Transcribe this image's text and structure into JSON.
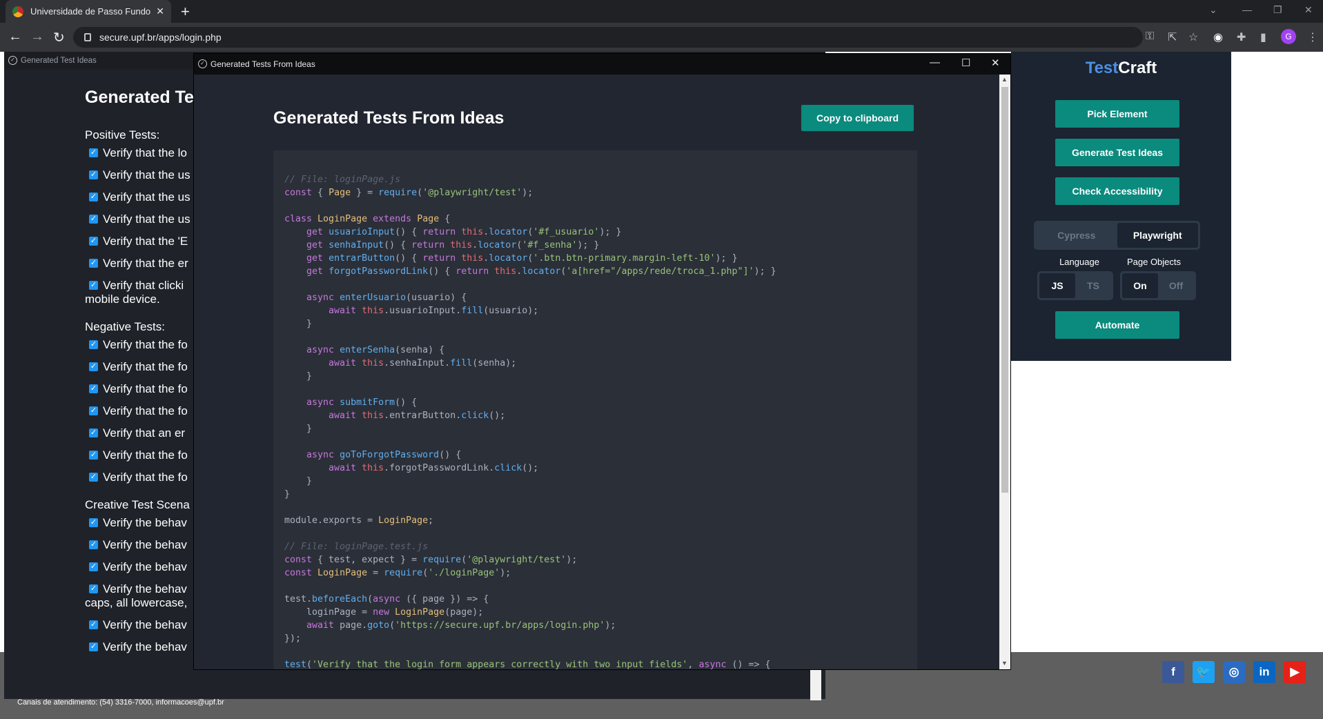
{
  "browser": {
    "tab_title": "Universidade de Passo Fundo - U",
    "url": "secure.upf.br/apps/login.php"
  },
  "page": {
    "footer_text": "Canais de atendimento: (54) 3316-7000, informacoes@upf.br",
    "social": [
      "f",
      "t",
      "ig",
      "in",
      "yt"
    ]
  },
  "bg_window": {
    "title": "Generated Test Ideas",
    "heading": "Generated Te",
    "positive_title": "Positive Tests:",
    "positive": [
      "Verify that the lo",
      "Verify that the us",
      "Verify that the us",
      "Verify that the us",
      "Verify that the 'E",
      "Verify that the er",
      "Verify that clicki",
      "mobile device."
    ],
    "negative_title": "Negative Tests:",
    "negative": [
      "Verify that the fo",
      "Verify that the fo",
      "Verify that the fo",
      "Verify that the fo",
      "Verify that an er",
      "Verify that the fo",
      "Verify that the fo"
    ],
    "creative_title": "Creative Test Scena",
    "creative": [
      "Verify the behav",
      "Verify the behav",
      "Verify the behav",
      "Verify the behav",
      "caps, all lowercase,",
      "Verify the behav",
      "Verify the behav"
    ]
  },
  "fg_window": {
    "title": "Generated Tests From Ideas",
    "heading": "Generated Tests From Ideas",
    "copy_label": "Copy to clipboard"
  },
  "testcraft": {
    "logo_part1": "Test",
    "logo_part2": "Craft",
    "pick_element": "Pick Element",
    "generate_ideas": "Generate Test Ideas",
    "check_accessibility": "Check Accessibility",
    "framework_options": [
      "Cypress",
      "Playwright"
    ],
    "framework_selected": "Playwright",
    "language_label": "Language",
    "language_options": [
      "JS",
      "TS"
    ],
    "page_objects_label": "Page Objects",
    "page_objects_options": [
      "On",
      "Off"
    ],
    "automate": "Automate"
  },
  "colors": {
    "accent": "#0b8a7e",
    "panel": "#1b2430",
    "logo_blue": "#4a90e2"
  }
}
